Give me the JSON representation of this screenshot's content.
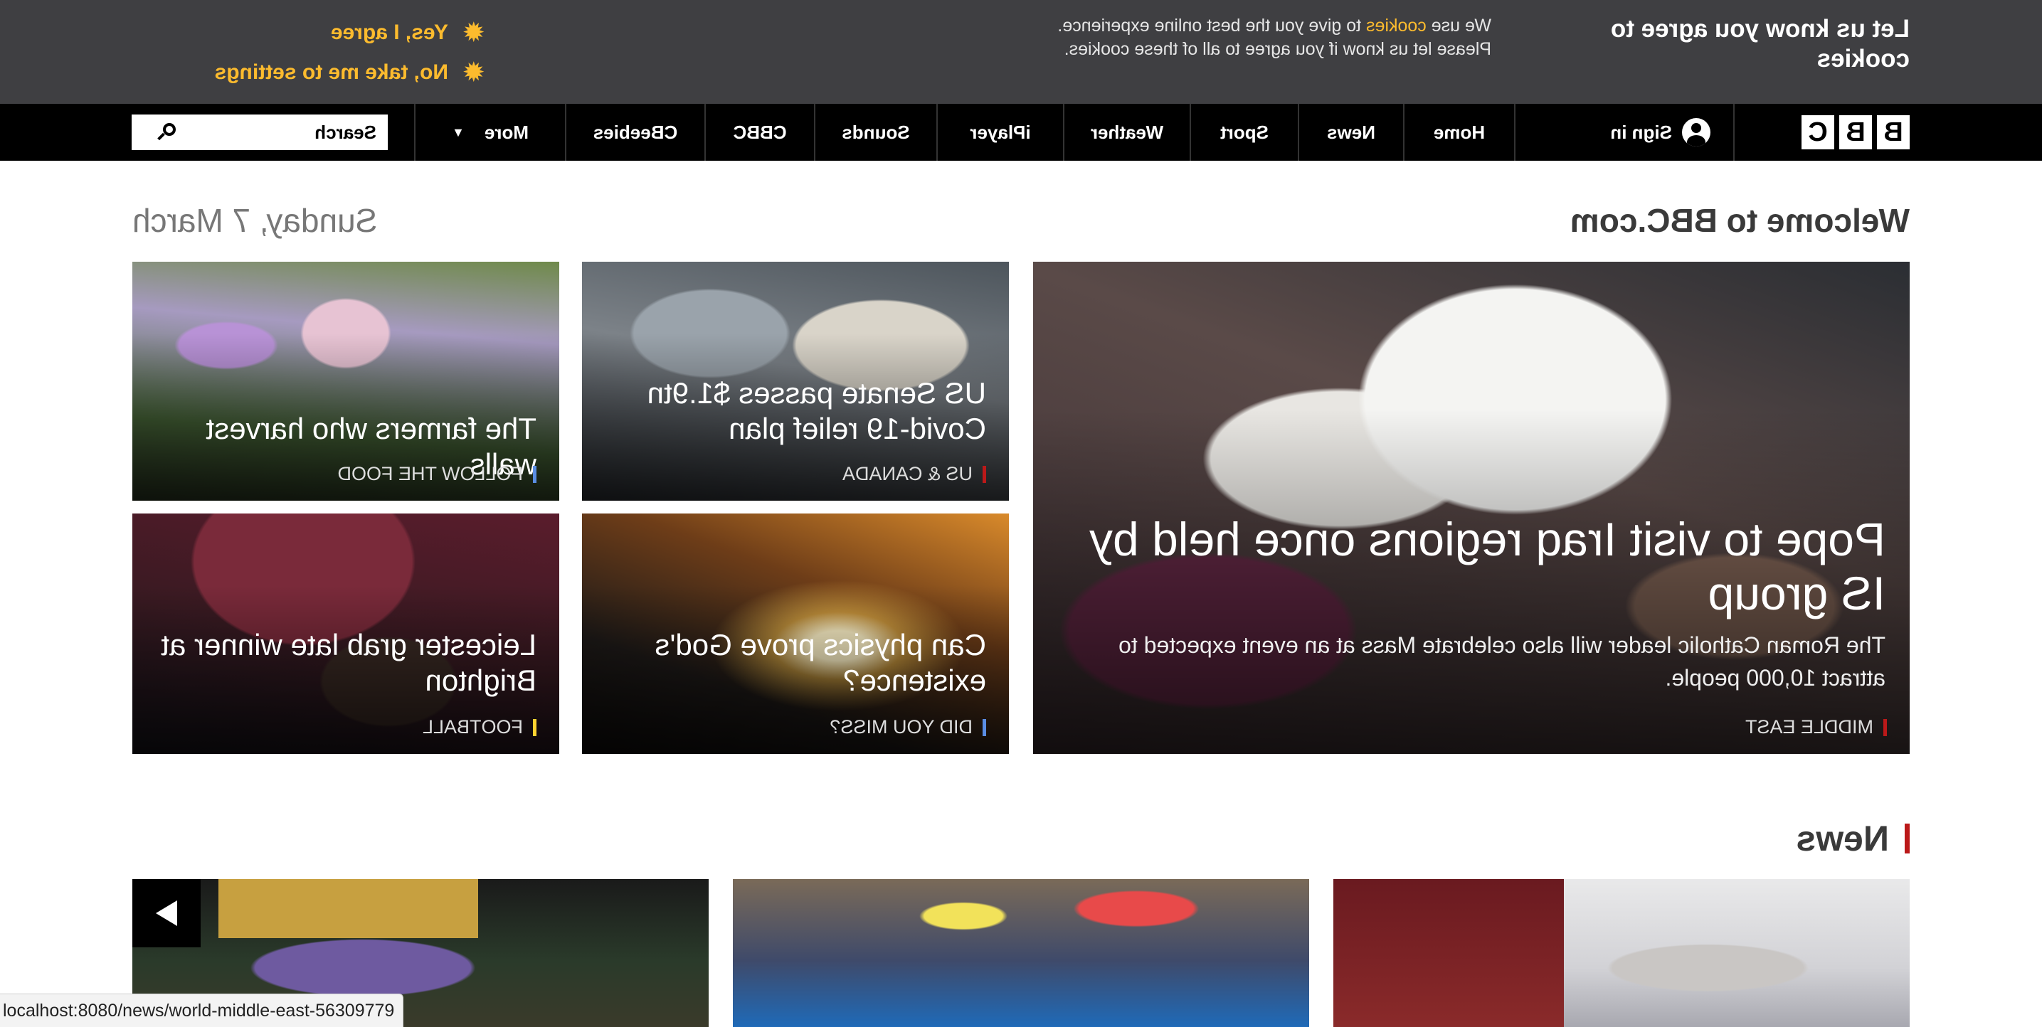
{
  "cookie_banner": {
    "title": "Let us know you agree to cookies",
    "text_before_link": "We use ",
    "link_text": "cookies",
    "text_after_link": " to give you the best online experience. Please let us know if you agree to all of these cookies.",
    "agree_label": "Yes, I agree",
    "settings_label": "No, take me to settings",
    "action_icon": "gear-icon",
    "accent_color": "#fcbb2e"
  },
  "nav": {
    "logo_letters": [
      "B",
      "B",
      "C"
    ],
    "sign_in_label": "Sign in",
    "items": [
      {
        "label": "Home"
      },
      {
        "label": "News"
      },
      {
        "label": "Sport"
      },
      {
        "label": "Weather"
      },
      {
        "label": "iPlayer"
      },
      {
        "label": "Sounds"
      },
      {
        "label": "CBBC"
      },
      {
        "label": "CBeebies"
      },
      {
        "label": "More",
        "has_dropdown": true
      }
    ],
    "search_placeholder": "Search"
  },
  "welcome": {
    "title": "Welcome to BBC.com",
    "date": "Sunday, 7 March"
  },
  "promos": [
    {
      "headline": "Pope to visit Iraq regions once held by IS group",
      "summary": "The Roman Catholic leader will also celebrate Mass at an event expected to attract 10,000 people.",
      "tag": "MIDDLE EAST",
      "tag_color": "#bb1919"
    },
    {
      "headline": "US Senate passes $1.9tn Covid-19 relief plan",
      "tag": "US & CANADA",
      "tag_color": "#bb1919"
    },
    {
      "headline": "The farmers who harvest walls",
      "tag": "FOLLOW THE FOOD",
      "tag_color": "#5a8de3"
    },
    {
      "headline": "Can physics prove God's existence?",
      "tag": "DID YOU MISS?",
      "tag_color": "#5a8de3"
    },
    {
      "headline": "Leicester grab late winner at Brighton",
      "tag": "FOOTBALL",
      "tag_color": "#ffd230"
    }
  ],
  "news_section": {
    "title": "News",
    "accent_color": "#bb1919"
  },
  "statusbar": {
    "url": "localhost:8080/news/world-middle-east-56309779"
  }
}
